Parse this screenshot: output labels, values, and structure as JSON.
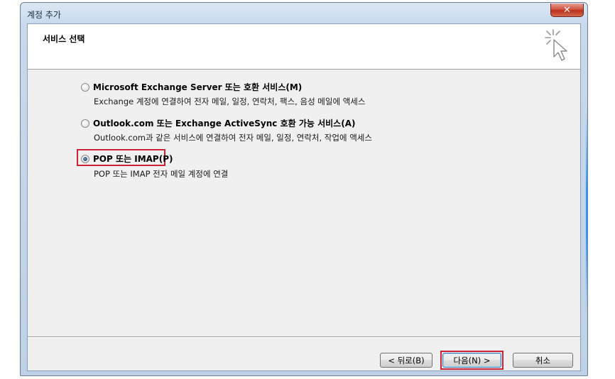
{
  "window": {
    "title": "계정 추가",
    "close_glyph": "✕"
  },
  "header": {
    "title": "서비스 선택",
    "icon": "wizard-cursor-icon"
  },
  "options": [
    {
      "label": "Microsoft Exchange Server 또는 호환 서비스(M)",
      "description": "Exchange 계정에 연결하여 전자 메일, 일정, 연락처, 팩스, 음성 메일에 액세스",
      "selected": false
    },
    {
      "label": "Outlook.com 또는 Exchange ActiveSync 호환 가능 서비스(A)",
      "description": "Outlook.com과 같은 서비스에 연결하여 전자 메일, 일정, 연락처, 작업에 액세스",
      "selected": false
    },
    {
      "label": "POP 또는 IMAP(P)",
      "description": "POP 또는 IMAP 전자 메일 계정에 연결",
      "selected": true
    }
  ],
  "buttons": {
    "back": "< 뒤로(B)",
    "next": "다음(N) >",
    "cancel": "취소"
  },
  "colors": {
    "highlight": "#cc2233",
    "frame": "#c9d9ec",
    "close": "#c7402b"
  }
}
